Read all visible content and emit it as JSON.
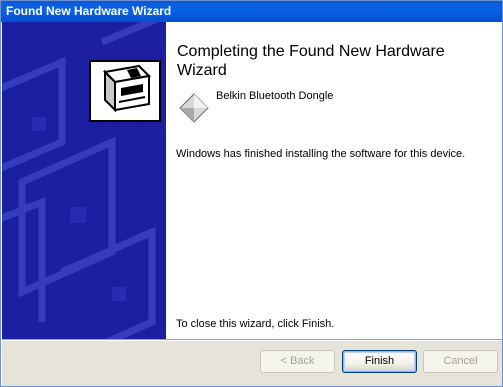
{
  "window": {
    "title": "Found New Hardware Wizard"
  },
  "content": {
    "heading": "Completing the Found New Hardware Wizard",
    "device_name": "Belkin Bluetooth Dongle",
    "finished_message": "Windows has finished installing the software for this device.",
    "close_message": "To close this wizard, click Finish."
  },
  "buttons": {
    "back": "< Back",
    "finish": "Finish",
    "cancel": "Cancel"
  },
  "colors": {
    "titlebar": "#0a5ad8",
    "side_panel": "#1d1fa3",
    "button_bar": "#e6e3d8"
  },
  "icons": {
    "wizard": "hardware-wizard-icon",
    "device": "device-diamond-icon"
  }
}
